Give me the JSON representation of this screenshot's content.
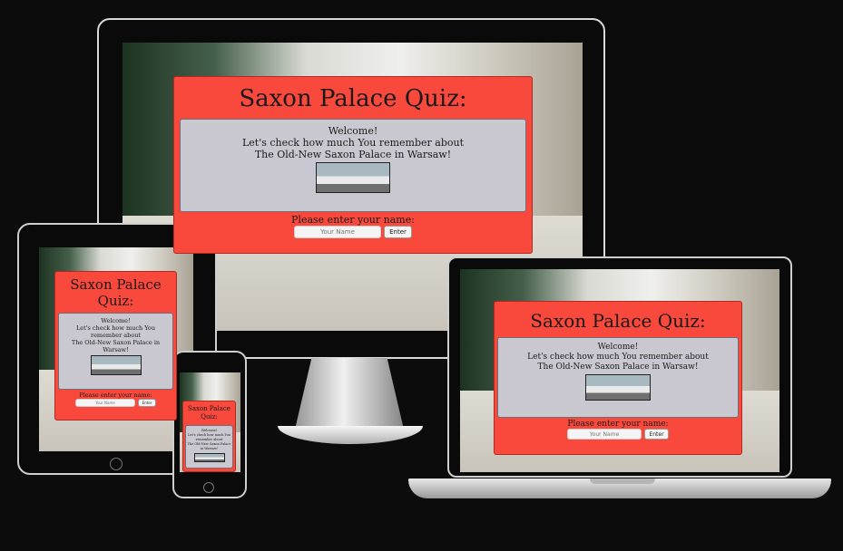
{
  "quiz": {
    "title": "Saxon Palace Quiz:",
    "welcome": "Welcome!",
    "line2": "Let's check how much You remember about",
    "line3": "The Old-New Saxon Palace in Warsaw!",
    "name_label": "Please enter your name:",
    "name_placeholder": "Your Name",
    "enter_label": "Enter"
  },
  "tablet_quiz": {
    "line2a": "Let's check how much You",
    "line2b": "remember about",
    "line3a": "The Old-New Saxon Palace in",
    "line3b": "Warsaw!"
  },
  "phone_quiz": {
    "title_a": "Saxon Palace",
    "title_b": "Quiz:",
    "line2a": "Let's check how much You",
    "line2b": "remember about",
    "line3a": "The Old-New Saxon Palace",
    "line3b": "in Warsaw!"
  },
  "colors": {
    "quiz_bg": "#f8493c",
    "intro_bg": "#c9c8d0",
    "page_bg": "#0c0c0c"
  }
}
